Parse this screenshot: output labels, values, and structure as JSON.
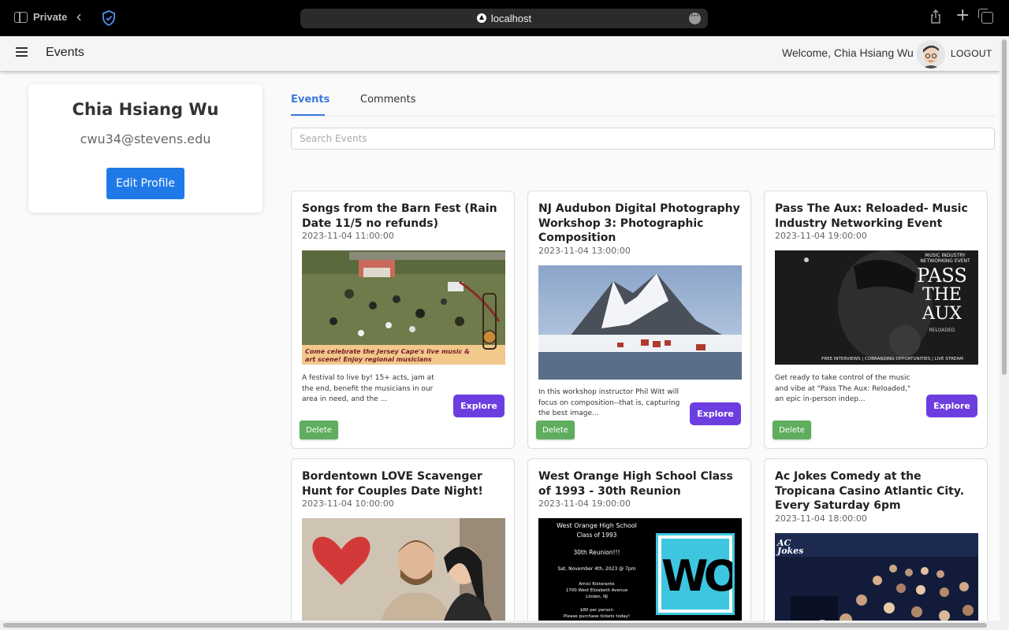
{
  "browser": {
    "private_label": "Private",
    "url": "localhost"
  },
  "appbar": {
    "title": "Events",
    "welcome": "Welcome, Chia Hsiang Wu",
    "logout_label": "LOGOUT"
  },
  "profile": {
    "name": "Chia Hsiang Wu",
    "email": "cwu34@stevens.edu",
    "edit_label": "Edit Profile"
  },
  "tabs": [
    {
      "label": "Events",
      "active": true
    },
    {
      "label": "Comments",
      "active": false
    }
  ],
  "search": {
    "placeholder": "Search Events",
    "value": ""
  },
  "buttons": {
    "explore": "Explore",
    "delete": "Delete"
  },
  "events": [
    {
      "title": "Songs from the Barn Fest (Rain Date 11/5 no refunds)",
      "date": "2023-11-04 11:00:00",
      "description": "A festival to live by! 15+ acts, jam at the end, benefit the musicians in our area in need, and the ...",
      "image_caption": "Come celebrate the Jersey Cape's live music & art scene! Enjoy regional musicians"
    },
    {
      "title": "NJ Audubon Digital Photography Workshop 3: Photographic Composition",
      "date": "2023-11-04 13:00:00",
      "description": "In this workshop instructor Phil Witt will focus on composition--that is, capturing the best image..."
    },
    {
      "title": "Pass The Aux: Reloaded- Music Industry Networking Event",
      "date": "2023-11-04 19:00:00",
      "description": "Get ready to take control of the music and vibe at \"Pass The Aux: Reloaded,\" an epic in-person indep...",
      "image_text": {
        "top": "MUSIC INDUSTRY NETWORKING EVENT",
        "line1": "PASS",
        "line2": "THE",
        "line3": "AUX",
        "sub": "RELOADED",
        "bottom": "FREE INTERVIEWS | COBRANDING OPPORTUNITIES | LIVE STREAM"
      }
    },
    {
      "title": "Bordentown LOVE Scavenger Hunt for Couples Date Night!",
      "date": "2023-11-04 10:00:00"
    },
    {
      "title": "West Orange High School Class of 1993 - 30th Reunion",
      "date": "2023-11-04 19:00:00",
      "image_text": {
        "line1": "West Orange High School",
        "line2": "Class of 1993",
        "line3": "30th Reunion!!!",
        "line4": "Sat, November 4th, 2023 @ 7pm",
        "line5": "Amici Ristorante",
        "line6": "1700 West Elizabeth Avenue",
        "line7": "Linden, NJ",
        "line8": "$80 per person",
        "line9": "Please purchase tickets today!",
        "logo": "WO"
      }
    },
    {
      "title": "Ac Jokes Comedy at the Tropicana Casino Atlantic City. Every Saturday 6pm",
      "date": "2023-11-04 18:00:00",
      "image_logo": "AC Jokes"
    }
  ],
  "colors": {
    "primary_blue": "#1f7ae8",
    "explore_purple": "#6c3ee0",
    "delete_green": "#5fae5f",
    "tab_active": "#3a79e0"
  }
}
